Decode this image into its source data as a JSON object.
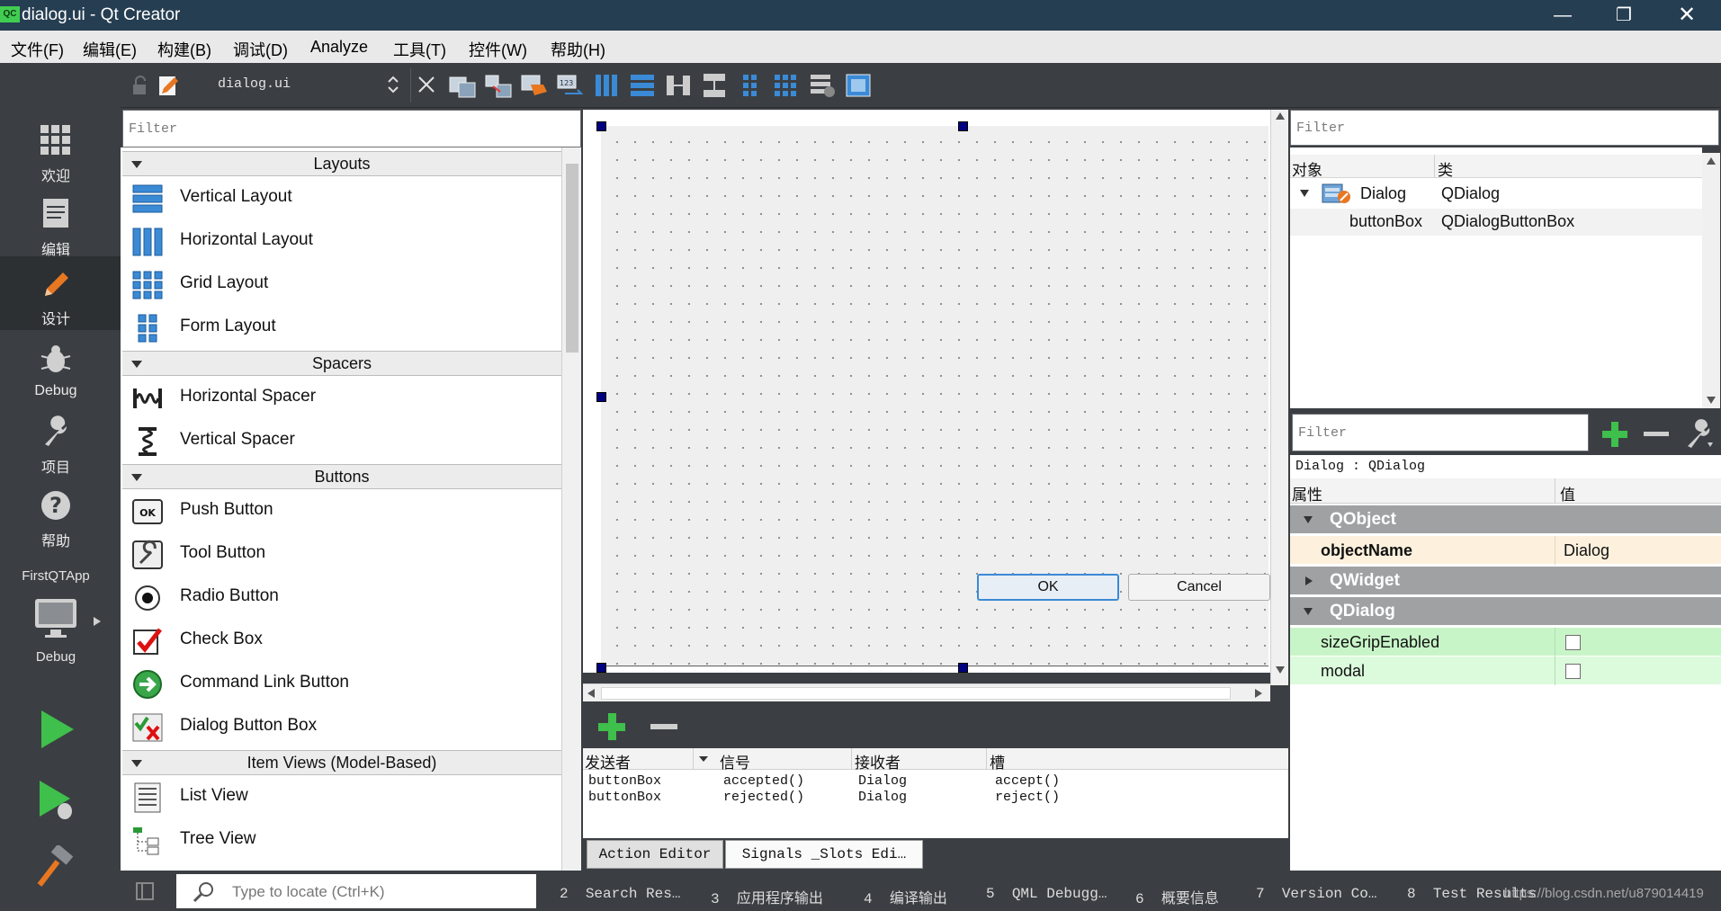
{
  "window": {
    "app_icon": "QC",
    "title": "dialog.ui - Qt Creator",
    "controls": [
      "minimize",
      "restore",
      "close"
    ]
  },
  "menu": [
    "文件(F)",
    "编辑(E)",
    "构建(B)",
    "调试(D)",
    "Analyze",
    "工具(T)",
    "控件(W)",
    "帮助(H)"
  ],
  "modes": {
    "welcome": "欢迎",
    "edit": "编辑",
    "design": "设计",
    "debug": "Debug",
    "projects": "项目",
    "help": "帮助",
    "target_project": "FirstQTApp",
    "target_config": "Debug"
  },
  "editor": {
    "file_name": "dialog.ui"
  },
  "widget_box": {
    "filter_placeholder": "Filter",
    "categories": {
      "layouts": "Layouts",
      "spacers": "Spacers",
      "buttons": "Buttons",
      "item_views": "Item Views (Model-Based)"
    },
    "items": {
      "vertical_layout": "Vertical Layout",
      "horizontal_layout": "Horizontal Layout",
      "grid_layout": "Grid Layout",
      "form_layout": "Form Layout",
      "horizontal_spacer": "Horizontal Spacer",
      "vertical_spacer": "Vertical Spacer",
      "push_button": "Push Button",
      "tool_button": "Tool Button",
      "radio_button": "Radio Button",
      "check_box": "Check Box",
      "command_link_button": "Command Link Button",
      "dialog_button_box": "Dialog Button Box",
      "list_view": "List View",
      "tree_view": "Tree View"
    }
  },
  "form": {
    "ok_button": "OK",
    "cancel_button": "Cancel"
  },
  "signals_slots": {
    "headers": {
      "sender": "发送者",
      "signal": "信号",
      "receiver": "接收者",
      "slot": "槽"
    },
    "rows": [
      {
        "sender": "buttonBox",
        "signal": "accepted()",
        "receiver": "Dialog",
        "slot": "accept()"
      },
      {
        "sender": "buttonBox",
        "signal": "rejected()",
        "receiver": "Dialog",
        "slot": "reject()"
      }
    ],
    "tabs": {
      "action_editor": "Action Editor",
      "signals_slots_editor": "Signals _Slots Edi…"
    }
  },
  "object_inspector": {
    "filter_placeholder": "Filter",
    "headers": {
      "object": "对象",
      "class": "类"
    },
    "rows": [
      {
        "object": "Dialog",
        "class": "QDialog"
      },
      {
        "object": "buttonBox",
        "class": "QDialogButtonBox"
      }
    ]
  },
  "property_editor": {
    "filter_placeholder": "Filter",
    "context": "Dialog : QDialog",
    "headers": {
      "property": "属性",
      "value": "值"
    },
    "groups": {
      "qobject": "QObject",
      "qwidget": "QWidget",
      "qdialog": "QDialog"
    },
    "object_name": {
      "name": "objectName",
      "value": "Dialog"
    },
    "size_grip_enabled": {
      "name": "sizeGripEnabled",
      "checked": false
    },
    "modal": {
      "name": "modal",
      "checked": false
    }
  },
  "statusbar": {
    "locator_placeholder": "Type to locate (Ctrl+K)",
    "panes": [
      {
        "num": "2",
        "label": "Search Res…"
      },
      {
        "num": "3",
        "label": "应用程序输出"
      },
      {
        "num": "4",
        "label": "编译输出"
      },
      {
        "num": "5",
        "label": "QML Debugg…"
      },
      {
        "num": "6",
        "label": "概要信息"
      },
      {
        "num": "7",
        "label": "Version Co…"
      },
      {
        "num": "8",
        "label": "Test Results"
      }
    ],
    "watermark": "https://blog.csdn.net/u879014419"
  },
  "colors": {
    "titlebar": "#263e52",
    "sidebar": "#3b3f43",
    "selection_blue": "#3b8ad6",
    "property_highlight": "#fdf1dd",
    "property_green": "#c8f5c8",
    "group_gray": "#9fa1a3"
  }
}
